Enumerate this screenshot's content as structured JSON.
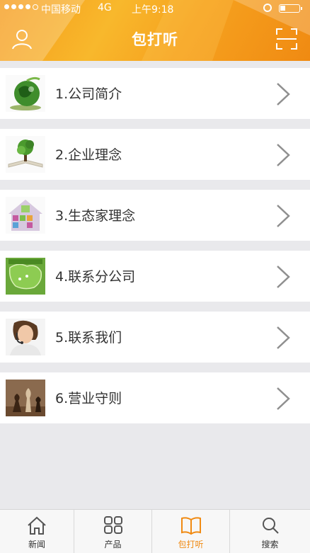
{
  "status_bar": {
    "carrier": "中国移动",
    "network": "4G",
    "time": "上午9:18"
  },
  "header": {
    "title": "包打听",
    "left_icon": "user-icon",
    "right_icon": "scan-icon"
  },
  "menu_items": [
    {
      "label": "1.公司简介",
      "icon": "globe-plant-thumbnail"
    },
    {
      "label": "2.企业理念",
      "icon": "tree-book-thumbnail"
    },
    {
      "label": "3.生态家理念",
      "icon": "house-thumbnail"
    },
    {
      "label": "4.联系分公司",
      "icon": "map-thumbnail"
    },
    {
      "label": "5.联系我们",
      "icon": "operator-thumbnail"
    },
    {
      "label": "6.营业守则",
      "icon": "chess-thumbnail"
    }
  ],
  "tabs": [
    {
      "label": "新闻",
      "icon": "home-icon",
      "active": false
    },
    {
      "label": "产品",
      "icon": "grid-icon",
      "active": false
    },
    {
      "label": "包打听",
      "icon": "book-icon",
      "active": true
    },
    {
      "label": "搜索",
      "icon": "search-icon",
      "active": false
    }
  ],
  "colors": {
    "accent": "#f08a12",
    "header": "#f7a520",
    "background": "#e9e9ec"
  }
}
